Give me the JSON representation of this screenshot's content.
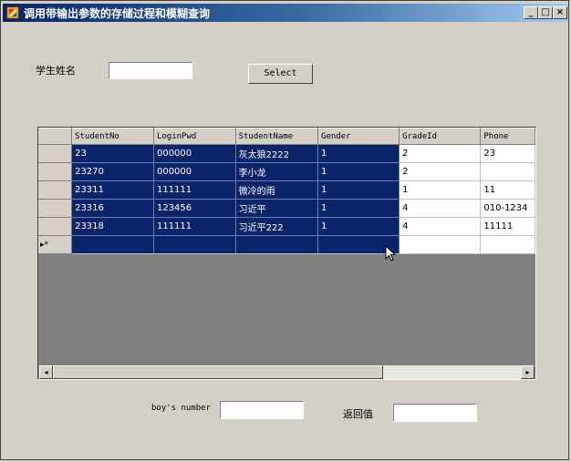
{
  "window": {
    "title": "调用带输出参数的存储过程和模糊查询",
    "controls": {
      "minimize": "_",
      "maximize": "□",
      "close": "×"
    }
  },
  "search": {
    "label": "学生姓名",
    "value": "",
    "button": "Select"
  },
  "grid": {
    "columns": [
      "StudentNo",
      "LoginPwd",
      "StudentName",
      "Gender",
      "GradeId",
      "Phone"
    ],
    "rows": [
      [
        "23",
        "000000",
        "灰太狼2222",
        "1",
        "2",
        "23"
      ],
      [
        "23270",
        "000000",
        "李小龙",
        "1",
        "2",
        ""
      ],
      [
        "23311",
        "111111",
        "微冷的雨",
        "1",
        "1",
        "11"
      ],
      [
        "23316",
        "123456",
        "习近平",
        "1",
        "4",
        "010-1234"
      ],
      [
        "23318",
        "111111",
        "习近平222",
        "1",
        "4",
        "11111"
      ]
    ],
    "new_row_marker": "▸*",
    "scroll": {
      "left": "◂",
      "right": "▸"
    }
  },
  "footer": {
    "boys_label": "boy's number",
    "boys_value": "",
    "return_label": "返回值",
    "return_value": ""
  }
}
